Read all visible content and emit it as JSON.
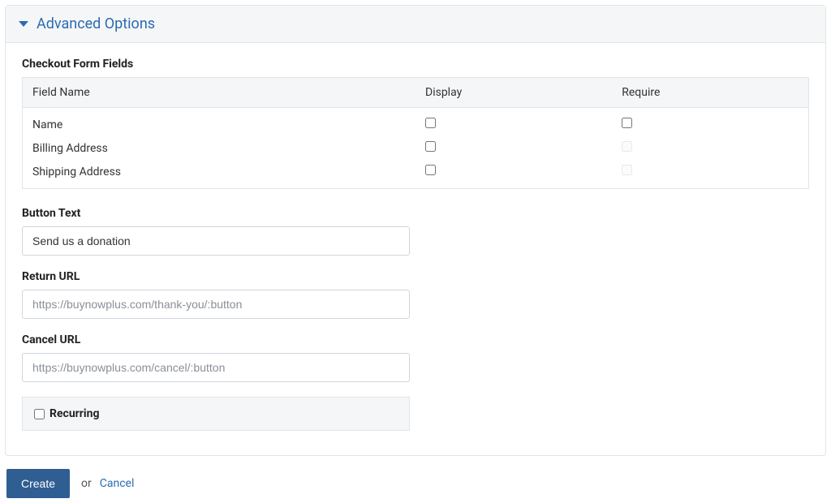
{
  "panel": {
    "title": "Advanced Options"
  },
  "checkoutFields": {
    "label": "Checkout Form Fields",
    "headers": {
      "fieldName": "Field Name",
      "display": "Display",
      "require": "Require"
    },
    "rows": [
      {
        "name": "Name",
        "display": false,
        "require": false,
        "requireDisabled": false
      },
      {
        "name": "Billing Address",
        "display": false,
        "require": false,
        "requireDisabled": true
      },
      {
        "name": "Shipping Address",
        "display": false,
        "require": false,
        "requireDisabled": true
      }
    ]
  },
  "buttonText": {
    "label": "Button Text",
    "value": "Send us a donation"
  },
  "returnUrl": {
    "label": "Return URL",
    "placeholder": "https://buynowplus.com/thank-you/:button",
    "value": ""
  },
  "cancelUrl": {
    "label": "Cancel URL",
    "placeholder": "https://buynowplus.com/cancel/:button",
    "value": ""
  },
  "recurring": {
    "label": "Recurring",
    "checked": false
  },
  "actions": {
    "create": "Create",
    "or": "or",
    "cancel": "Cancel"
  }
}
